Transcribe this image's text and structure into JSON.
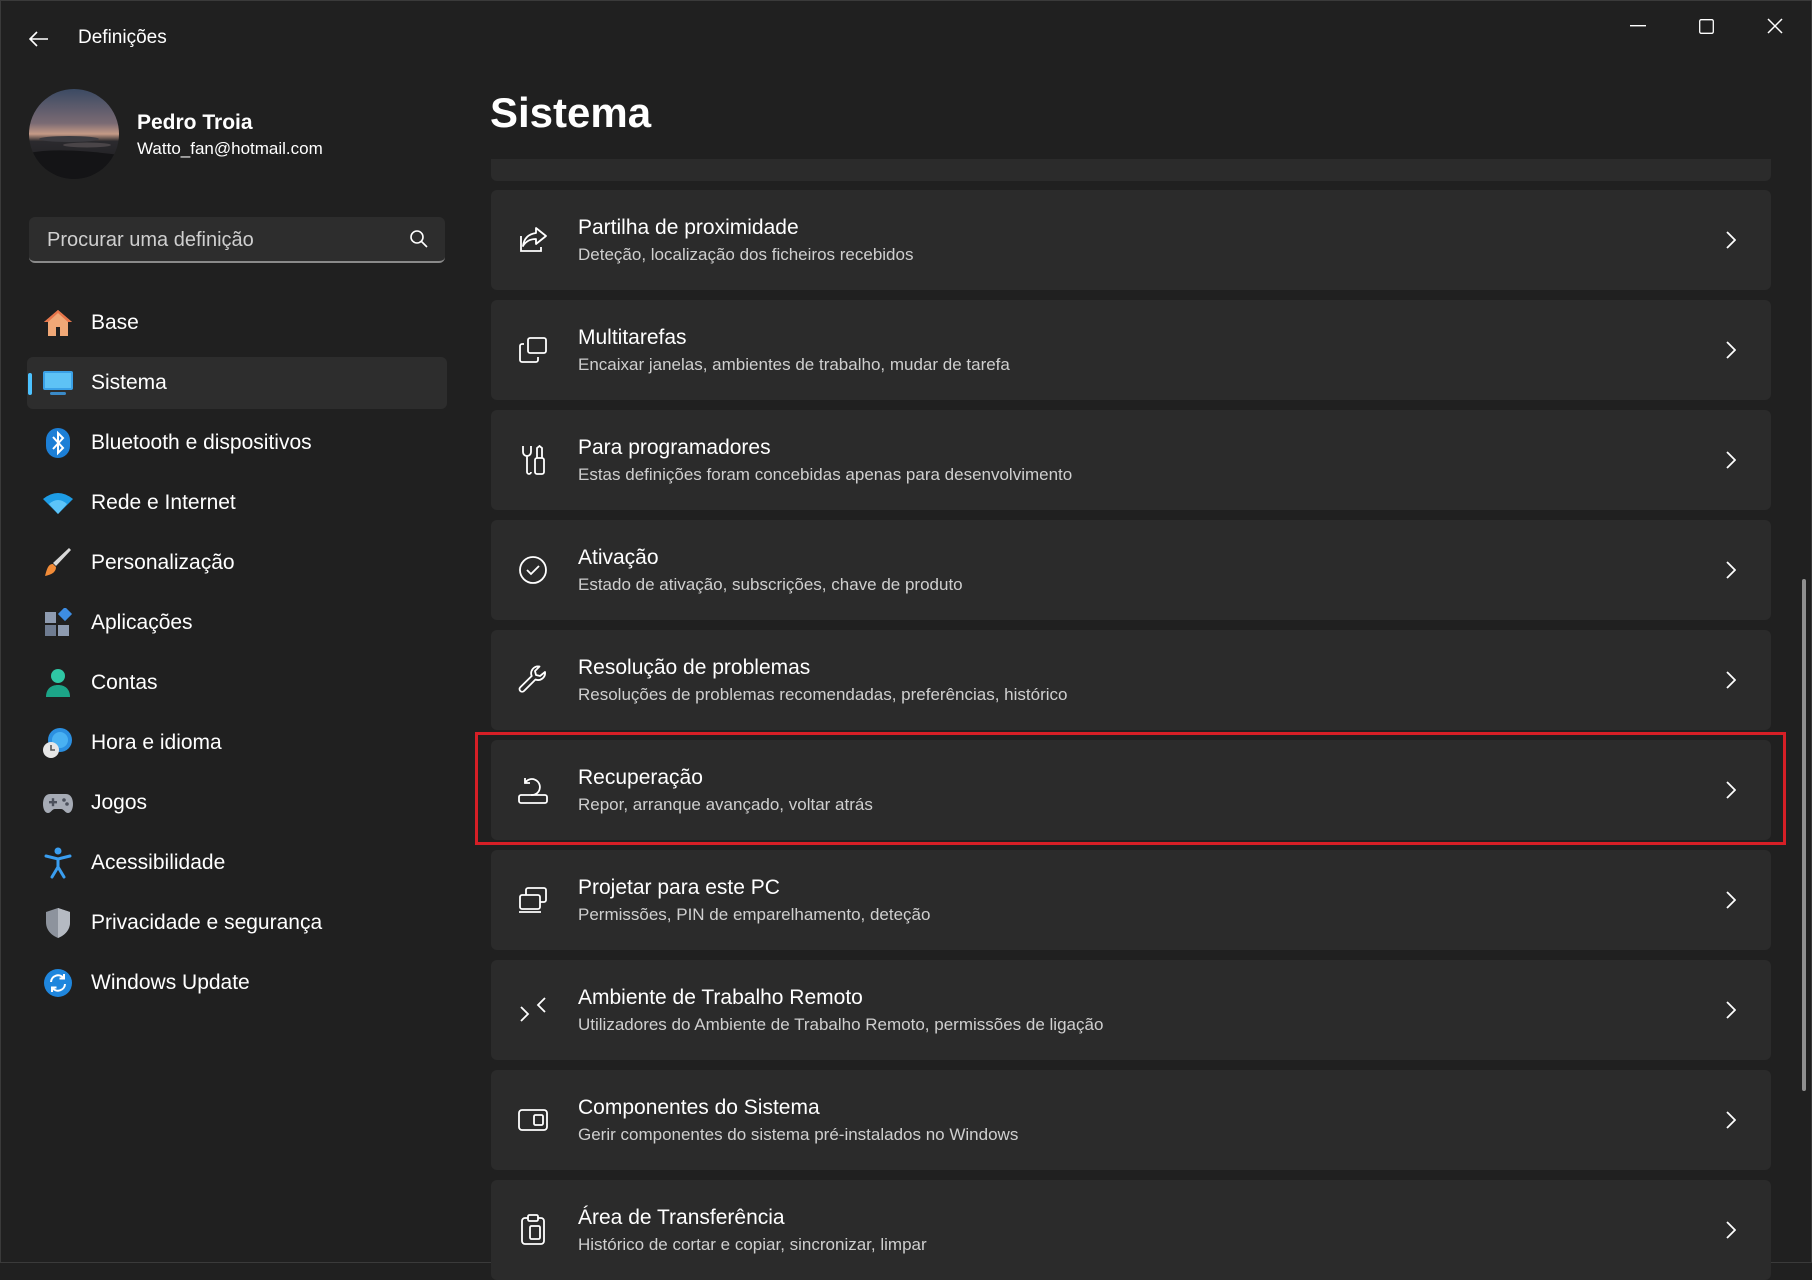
{
  "app": {
    "title": "Definições"
  },
  "profile": {
    "name": "Pedro Troia",
    "email": "Watto_fan@hotmail.com"
  },
  "search": {
    "placeholder": "Procurar uma definição"
  },
  "sidebar": {
    "items": [
      {
        "label": "Base",
        "icon": "home-icon",
        "selected": false
      },
      {
        "label": "Sistema",
        "icon": "monitor-icon",
        "selected": true
      },
      {
        "label": "Bluetooth e dispositivos",
        "icon": "bluetooth-icon",
        "selected": false
      },
      {
        "label": "Rede e Internet",
        "icon": "wifi-icon",
        "selected": false
      },
      {
        "label": "Personalização",
        "icon": "paintbrush-icon",
        "selected": false
      },
      {
        "label": "Aplicações",
        "icon": "apps-icon",
        "selected": false
      },
      {
        "label": "Contas",
        "icon": "person-icon",
        "selected": false
      },
      {
        "label": "Hora e idioma",
        "icon": "globe-clock-icon",
        "selected": false
      },
      {
        "label": "Jogos",
        "icon": "gamepad-icon",
        "selected": false
      },
      {
        "label": "Acessibilidade",
        "icon": "accessibility-icon",
        "selected": false
      },
      {
        "label": "Privacidade e segurança",
        "icon": "shield-icon",
        "selected": false
      },
      {
        "label": "Windows Update",
        "icon": "update-icon",
        "selected": false
      }
    ]
  },
  "main": {
    "title": "Sistema",
    "cards": [
      {
        "title": "Partilha de proximidade",
        "subtitle": "Deteção, localização dos ficheiros recebidos",
        "icon": "share-icon"
      },
      {
        "title": "Multitarefas",
        "subtitle": "Encaixar janelas, ambientes de trabalho, mudar de tarefa",
        "icon": "multitask-icon"
      },
      {
        "title": "Para programadores",
        "subtitle": "Estas definições foram concebidas apenas para desenvolvimento",
        "icon": "developer-tools-icon"
      },
      {
        "title": "Ativação",
        "subtitle": "Estado de ativação, subscrições, chave de produto",
        "icon": "checkmark-circle-icon"
      },
      {
        "title": "Resolução de problemas",
        "subtitle": "Resoluções de problemas recomendadas, preferências, histórico",
        "icon": "wrench-icon"
      },
      {
        "title": "Recuperação",
        "subtitle": "Repor, arranque avançado, voltar atrás",
        "icon": "recovery-icon"
      },
      {
        "title": "Projetar para este PC",
        "subtitle": "Permissões, PIN de emparelhamento, deteção",
        "icon": "project-icon"
      },
      {
        "title": "Ambiente de Trabalho Remoto",
        "subtitle": "Utilizadores do Ambiente de Trabalho Remoto, permissões de ligação",
        "icon": "remote-desktop-icon"
      },
      {
        "title": "Componentes do Sistema",
        "subtitle": "Gerir componentes do sistema pré-instalados no Windows",
        "icon": "system-components-icon"
      },
      {
        "title": "Área de Transferência",
        "subtitle": "Histórico de cortar e copiar, sincronizar, limpar",
        "icon": "clipboard-icon"
      }
    ]
  },
  "colors": {
    "background": "#202020",
    "card": "#2b2b2b",
    "accent": "#4cc2ff",
    "highlight": "#d61f26"
  }
}
